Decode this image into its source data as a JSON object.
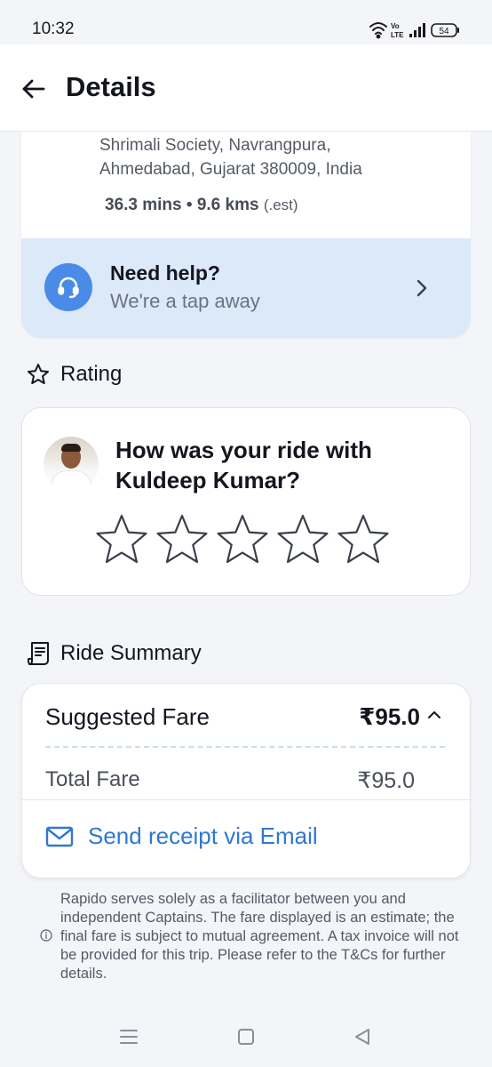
{
  "status_bar": {
    "time": "10:32",
    "battery": "54",
    "icons": [
      "wifi-icon",
      "volte-icon",
      "signal-icon",
      "battery-icon"
    ]
  },
  "header": {
    "title": "Details",
    "back_icon": "arrow-left-icon"
  },
  "drop": {
    "address_line1": "Shrimali Society, Navrangpura,",
    "address_line2": "Ahmedabad, Gujarat 380009, India",
    "eta": "36.3 mins • 9.6 kms",
    "eta_note": "(.est)"
  },
  "help": {
    "title": "Need help?",
    "subtitle": "We're a tap away",
    "icon": "headset-icon"
  },
  "rating": {
    "heading": "Rating",
    "question": "How was your ride with Kuldeep Kumar?",
    "max_stars": 5,
    "selected_stars": 0
  },
  "summary": {
    "heading": "Ride Summary",
    "suggested_fare_label": "Suggested Fare",
    "suggested_fare_value": "₹95.0",
    "total_fare_label": "Total Fare",
    "total_fare_value": "₹95.0",
    "email_button": "Send receipt via Email"
  },
  "disclaimer": "Rapido serves solely as a facilitator between you and independent Captains. The fare displayed is an estimate; the final fare is subject to mutual agreement. A tax invoice will not be provided for this trip. Please refer to the T&Cs for further details.",
  "colors": {
    "accent_blue": "#2f78d2",
    "help_bg": "#dce9f9",
    "help_icon_bg": "#4a8be8",
    "page_bg": "#f4f5f8"
  }
}
